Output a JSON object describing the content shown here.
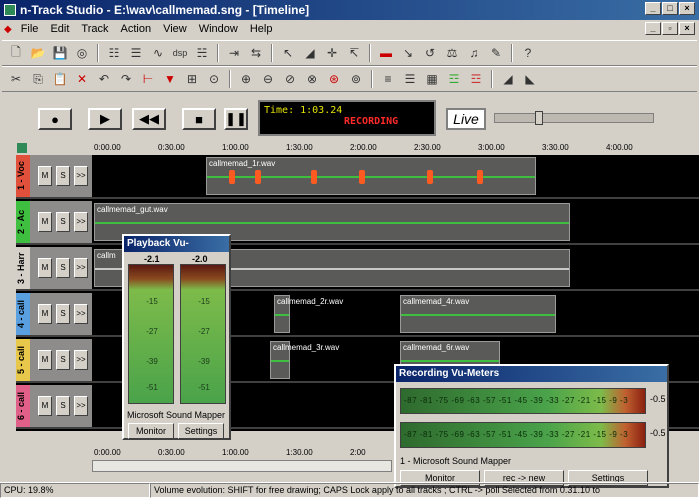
{
  "window": {
    "title": "n-Track Studio - E:\\wav\\callmemad.sng - [Timeline]"
  },
  "menu": [
    "File",
    "Edit",
    "Track",
    "Action",
    "View",
    "Window",
    "Help"
  ],
  "transport": {
    "time_display": "Time: 1:03.24",
    "status_display": "RECORDING",
    "live_label": "Live"
  },
  "ruler_ticks": [
    "0:00.00",
    "0:30.00",
    "1:00.00",
    "1:30.00",
    "2:00.00",
    "2:30.00",
    "3:00.00",
    "3:30.00",
    "4:00.00"
  ],
  "bottom_ruler_ticks": [
    "0:00.00",
    "0:30.00",
    "1:00.00",
    "1:30.00",
    "2:00"
  ],
  "track_buttons": {
    "mute": "M",
    "solo": "S",
    "more": ">>"
  },
  "tracks": [
    {
      "name": "1 - Voc",
      "color": "#e0503a",
      "parts": [
        {
          "label": "callmemad_1r.wav"
        }
      ]
    },
    {
      "name": "2 - Ac",
      "color": "#3fbf3f",
      "parts": [
        {
          "label": "callmemad_gut.wav"
        }
      ]
    },
    {
      "name": "3 - Harr",
      "color": "#d4d0c8",
      "parts": [
        {
          "label": "callm"
        }
      ]
    },
    {
      "name": "4 - call",
      "color": "#5aa0e0",
      "parts": [
        {
          "label": "callmemad_2r.wav"
        },
        {
          "label": "callmemad_4r.wav"
        }
      ]
    },
    {
      "name": "5 - call",
      "color": "#e8c84a",
      "parts": [
        {
          "label": "callmemad_3r.wav"
        },
        {
          "label": "callmemad_6r.wav"
        }
      ]
    },
    {
      "name": "6 - call",
      "color": "#e0608a",
      "parts": []
    }
  ],
  "playback_vu": {
    "title": "Playback Vu-",
    "left_peak": "-2.1",
    "right_peak": "-2.0",
    "scale": [
      "-15",
      "-27",
      "-39",
      "-51"
    ],
    "device": "Microsoft Sound Mapper",
    "monitor_label": "Monitor",
    "settings_label": "Settings"
  },
  "recording_vu": {
    "title": "Recording Vu-Meters",
    "scale_text": "-87 -81 -75 -69 -63 -57 -51 -45 -39 -33 -27 -21 -15 -9 -3",
    "peak_top": "-0.5",
    "peak_bottom": "-0.5",
    "device": "1 - Microsoft Sound Mapper",
    "monitor_label": "Monitor",
    "rec_label": "rec -> new",
    "settings_label": "Settings"
  },
  "status": {
    "cpu": "CPU: 19.8%",
    "message": "Volume evolution: SHIFT for free drawing; CAPS Lock apply to all tracks ; CTRL -> poll  Selected from 0.31.10 to"
  }
}
